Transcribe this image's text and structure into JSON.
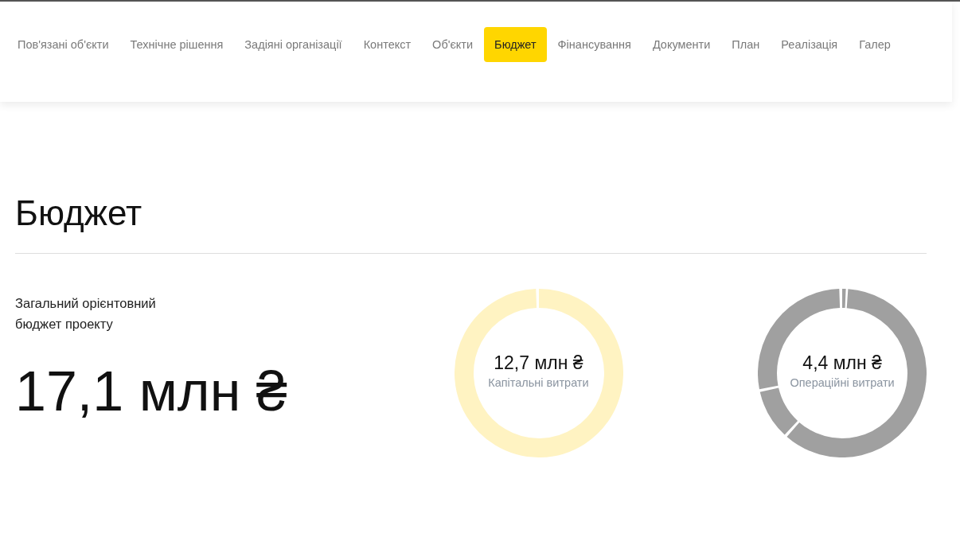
{
  "tabs": [
    {
      "label": "Пов'язані об'єкти",
      "selected": false
    },
    {
      "label": "Технічне рішення",
      "selected": false
    },
    {
      "label": "Задіяні організації",
      "selected": false
    },
    {
      "label": "Контекст",
      "selected": false
    },
    {
      "label": "Об'єкти",
      "selected": false
    },
    {
      "label": "Бюджет",
      "selected": true
    },
    {
      "label": "Фінансування",
      "selected": false
    },
    {
      "label": "Документи",
      "selected": false
    },
    {
      "label": "План",
      "selected": false
    },
    {
      "label": "Реалізація",
      "selected": false
    },
    {
      "label": "Галер",
      "selected": false
    }
  ],
  "heading": "Бюджет",
  "total": {
    "label": "Загальний орієнтовний бюджет проекту",
    "value": "17,1 млн ₴"
  },
  "breakdown": [
    {
      "value": "12,7 млн ₴",
      "label": "Капітальні витрати",
      "color": "#fff3c2"
    },
    {
      "value": "4,4 млн ₴",
      "label": "Операційні витрати",
      "color": "#a0a0a0"
    }
  ]
}
